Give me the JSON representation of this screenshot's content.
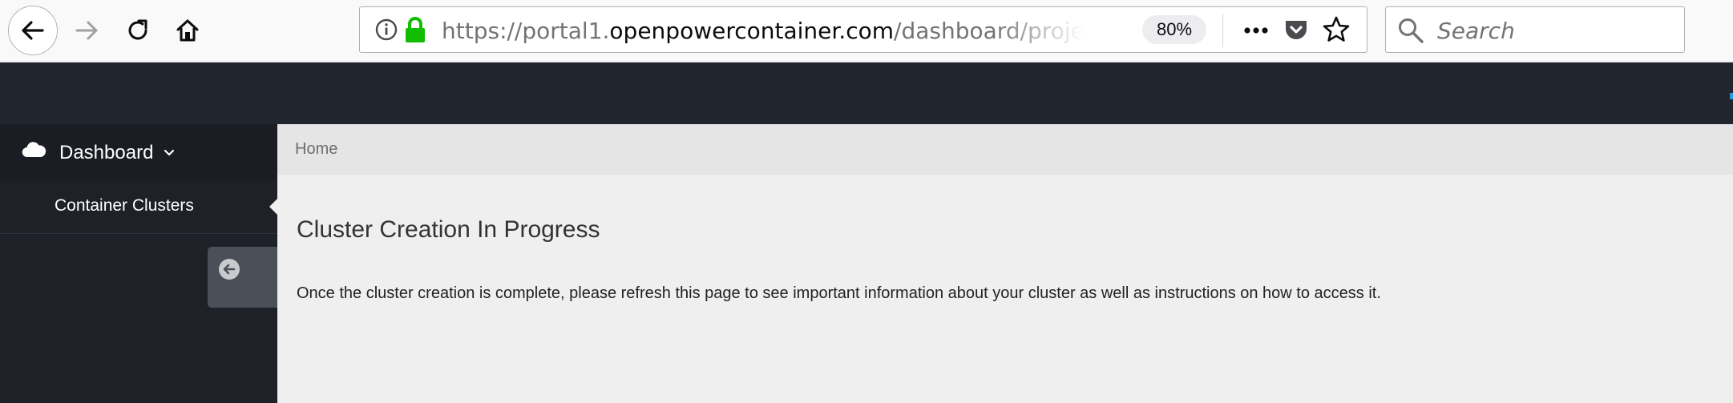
{
  "browser": {
    "url": {
      "prefix": "https://portal1.",
      "domain": "openpowercontainer.com",
      "path": "/dashboard/project/stack"
    },
    "zoom": "80%",
    "search_placeholder": "Search",
    "icons": {
      "back": "back-arrow-icon",
      "forward": "forward-arrow-icon",
      "reload": "reload-icon",
      "home": "home-icon",
      "info": "info-icon",
      "lock": "lock-icon",
      "page_actions": "more-dots-icon",
      "pocket": "pocket-icon",
      "bookmark": "star-icon",
      "search": "search-icon"
    }
  },
  "sidebar": {
    "dashboard_label": "Dashboard",
    "items": [
      {
        "label": "Container Clusters"
      }
    ]
  },
  "breadcrumb": {
    "home": "Home"
  },
  "main": {
    "title": "Cluster Creation In Progress",
    "text": "Once the cluster creation is complete, please refresh this page to see important information about your cluster as well as instructions on how to access it."
  },
  "colors": {
    "topbar": "#21252e",
    "sidebar": "#1e2128",
    "lock_green": "#12bc00",
    "content_bg": "#efefef"
  }
}
